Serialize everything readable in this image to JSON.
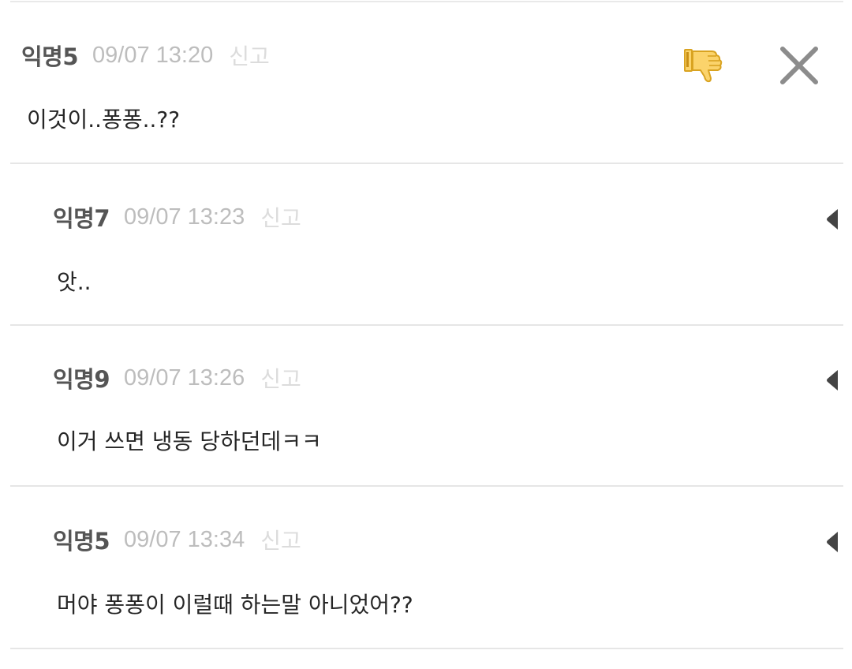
{
  "comments": [
    {
      "author": "익명5",
      "time": "09/07 13:20",
      "report_label": "신고",
      "body": "이것이..퐁퐁..??",
      "is_reply": false
    },
    {
      "author": "익명7",
      "time": "09/07 13:23",
      "report_label": "신고",
      "body": "앗..",
      "is_reply": true
    },
    {
      "author": "익명9",
      "time": "09/07 13:26",
      "report_label": "신고",
      "body": "이거 쓰면 냉동 당하던데ㅋㅋ",
      "is_reply": true
    },
    {
      "author": "익명5",
      "time": "09/07 13:34",
      "report_label": "신고",
      "body": "머야 퐁퐁이 이럴때 하는말 아니었어??",
      "is_reply": true
    }
  ],
  "icons": {
    "dislike": "thumbs-down-icon",
    "close": "close-icon",
    "reply_menu": "caret-left-icon"
  },
  "colors": {
    "author": "#555555",
    "time": "#bdbdbd",
    "report": "#dcdcdc",
    "body": "#262626",
    "divider": "#e6e6e6",
    "thumb_fill": "#fbd36b",
    "thumb_outline": "#d9a321",
    "close": "#8c8c8c",
    "caret": "#444444"
  }
}
